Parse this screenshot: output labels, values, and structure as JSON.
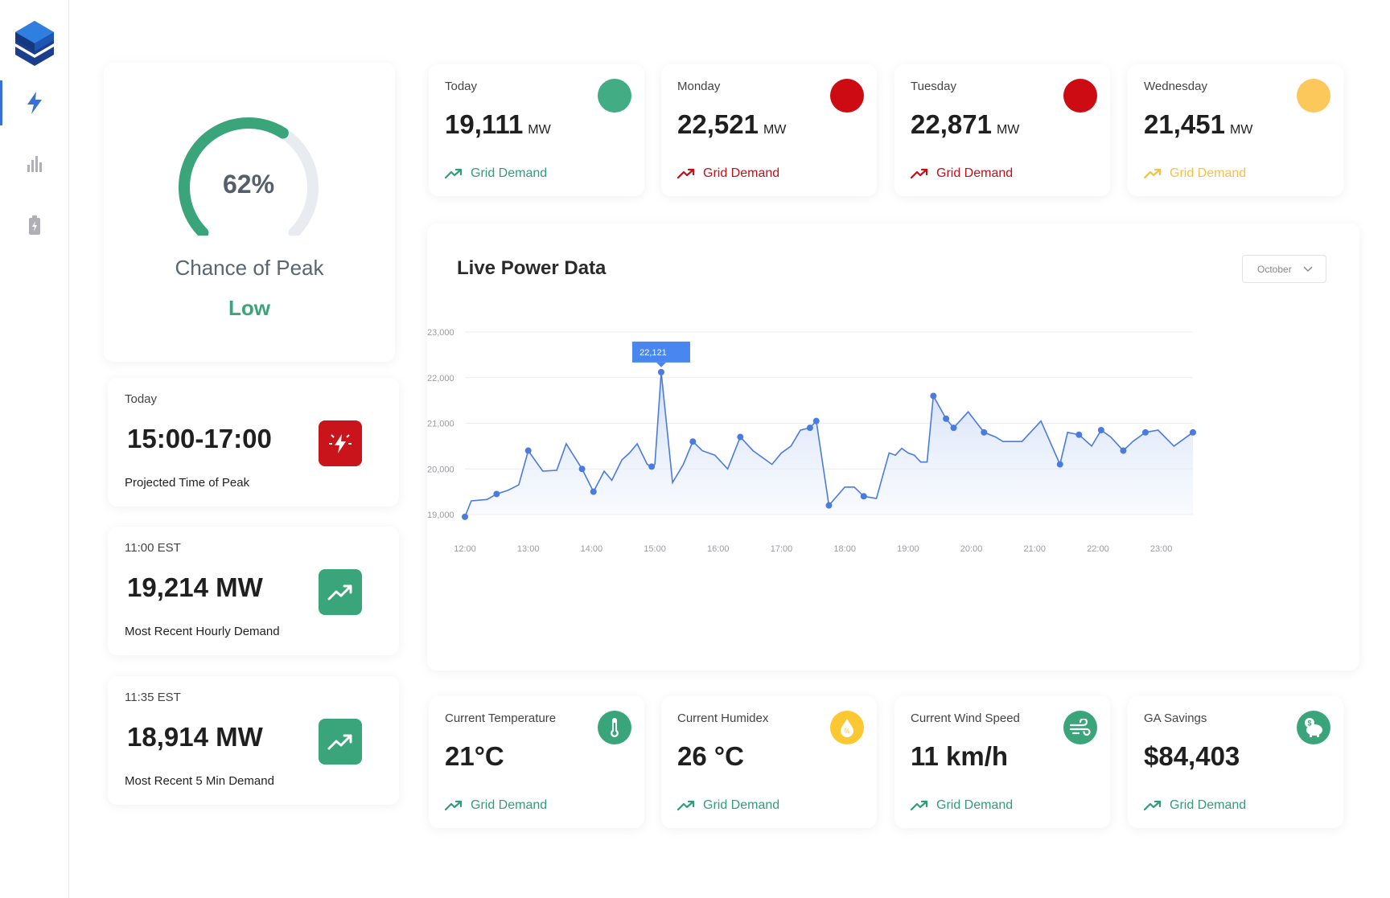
{
  "app": {
    "nav": [
      {
        "name": "power-nav",
        "active": true
      },
      {
        "name": "chart-nav",
        "active": false
      },
      {
        "name": "battery-nav",
        "active": false
      }
    ]
  },
  "peak": {
    "percent": 62,
    "percent_label": "62%",
    "title": "Chance of Peak",
    "status": "Low",
    "status_color": "#3aa57a"
  },
  "side_cards": [
    {
      "label": "Today",
      "value": "15:00-17:00",
      "caption": "Projected Time of Peak",
      "icon": "lightning-alert-icon",
      "color": "#c8141a"
    },
    {
      "label": "11:00 EST",
      "value": "19,214 MW",
      "caption": "Most Recent Hourly Demand",
      "icon": "trending-up-icon",
      "color": "#3aa57a"
    },
    {
      "label": "11:35 EST",
      "value": "18,914 MW",
      "caption": "Most Recent 5 Min Demand",
      "icon": "trending-up-icon",
      "color": "#3aa57a"
    }
  ],
  "forecast": [
    {
      "day": "Today",
      "value": "19,111",
      "unit": "MW",
      "trend": "Grid Demand",
      "dot_color": "#42ad84",
      "trend_color": "#2f9e76"
    },
    {
      "day": "Monday",
      "value": "22,521",
      "unit": "MW",
      "trend": "Grid Demand",
      "dot_color": "#cc0c12",
      "trend_color": "#c01018"
    },
    {
      "day": "Tuesday",
      "value": "22,871",
      "unit": "MW",
      "trend": "Grid Demand",
      "dot_color": "#cc0c12",
      "trend_color": "#c01018"
    },
    {
      "day": "Wednesday",
      "value": "21,451",
      "unit": "MW",
      "trend": "Grid Demand",
      "dot_color": "#fcc85c",
      "trend_color": "#f5c046"
    }
  ],
  "live": {
    "title": "Live Power Data",
    "month": "October"
  },
  "chart_data": {
    "type": "area",
    "ylim": [
      19000,
      23000
    ],
    "y_ticks": [
      "23,000",
      "22,000",
      "21,000",
      "20,000",
      "19,000"
    ],
    "y_tick_values": [
      23000,
      22000,
      21000,
      20000,
      19000
    ],
    "x_ticks": [
      "12:00",
      "13:00",
      "14:00",
      "15:00",
      "16:00",
      "17:00",
      "18:00",
      "19:00",
      "20:00",
      "21:00",
      "22:00",
      "23:00"
    ],
    "xlim": [
      12.0,
      23.5
    ],
    "annotation": {
      "x": 15.1,
      "y": 22121,
      "label": "22,121"
    },
    "series": [
      {
        "x": [
          12.0,
          12.1,
          12.35,
          12.5,
          12.68,
          12.85,
          13.0,
          13.23,
          13.45,
          13.6,
          13.85,
          14.03,
          14.2,
          14.32,
          14.48,
          14.6,
          14.72,
          14.88,
          14.95,
          15.0,
          15.1,
          15.28,
          15.45,
          15.6,
          15.75,
          15.95,
          16.15,
          16.35,
          16.55,
          16.7,
          16.85,
          17.0,
          17.15,
          17.3,
          17.45,
          17.55,
          17.75,
          18.0,
          18.15,
          18.3,
          18.5,
          18.7,
          18.8,
          18.9,
          19.0,
          19.1,
          19.2,
          19.3,
          19.4,
          19.6,
          19.72,
          19.95,
          20.2,
          20.38,
          20.5,
          20.8,
          21.1,
          21.4,
          21.52,
          21.7,
          21.9,
          22.05,
          22.2,
          22.4,
          22.55,
          22.75,
          22.95,
          23.2,
          23.5
        ],
        "y": [
          18950,
          19300,
          19330,
          19450,
          19530,
          19650,
          20400,
          19950,
          19970,
          20550,
          20000,
          19500,
          19950,
          19750,
          20200,
          20350,
          20550,
          20100,
          20050,
          20100,
          22121,
          19700,
          20100,
          20600,
          20400,
          20300,
          20000,
          20700,
          20400,
          20250,
          20100,
          20350,
          20500,
          20850,
          20900,
          21050,
          19200,
          19600,
          19600,
          19400,
          19350,
          20350,
          20300,
          20450,
          20350,
          20300,
          20150,
          20150,
          21600,
          21100,
          20900,
          21250,
          20800,
          20700,
          20600,
          20600,
          21050,
          20100,
          20800,
          20750,
          20500,
          20850,
          20700,
          20400,
          20600,
          20800,
          20850,
          20500,
          20800
        ]
      }
    ]
  },
  "conditions": [
    {
      "label": "Current Temperature",
      "value": "21°C",
      "trend": "Grid Demand",
      "icon": "thermometer-icon",
      "color": "#3aa57a"
    },
    {
      "label": "Current Humidex",
      "value": "26 °C",
      "trend": "Grid Demand",
      "icon": "humidity-drop-icon",
      "color": "#fcc832"
    },
    {
      "label": "Current Wind Speed",
      "value": "11 km/h",
      "trend": "Grid Demand",
      "icon": "wind-icon",
      "color": "#3aa57a"
    },
    {
      "label": "GA Savings",
      "value": "$84,403",
      "trend": "Grid Demand",
      "icon": "piggy-bank-icon",
      "color": "#3aa57a"
    }
  ],
  "colors": {
    "accent": "#3b6fd8",
    "line": "#4a7be0",
    "tooltip": "#4a86f0",
    "green_text": "#2f9e76"
  }
}
